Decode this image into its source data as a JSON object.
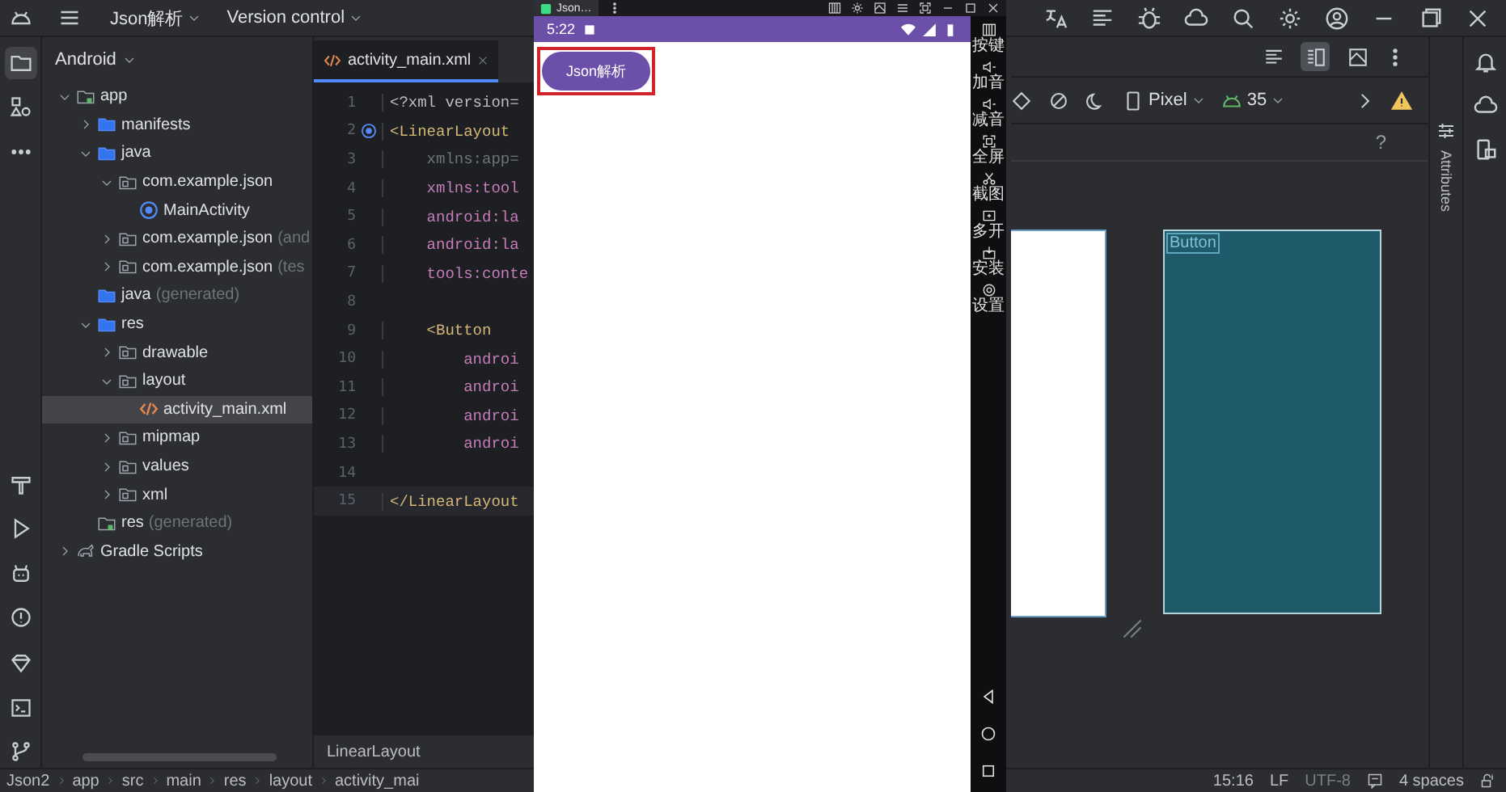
{
  "top_bar": {
    "project": "Json解析",
    "vcs": "Version control"
  },
  "left_toolbar": [
    {
      "selected": true
    },
    {
      "selected": false
    },
    {
      "selected": false
    },
    {
      "selected": false
    },
    {
      "selected": false
    },
    {
      "selected": false
    },
    {
      "selected": false
    },
    {
      "selected": false
    },
    {
      "selected": false
    },
    {
      "selected": false
    }
  ],
  "project_panel": {
    "view": "Android",
    "tree": [
      {
        "label": "app",
        "kind": "module",
        "expanded": true,
        "selected": false,
        "children": [
          {
            "label": "manifests",
            "kind": "folder",
            "expanded": false,
            "selected": false
          },
          {
            "label": "java",
            "kind": "folder",
            "expanded": true,
            "selected": false,
            "children": [
              {
                "label": "com.example.json",
                "kind": "package",
                "expanded": true,
                "selected": false,
                "children": [
                  {
                    "label": "MainActivity",
                    "kind": "class",
                    "selected": false
                  }
                ]
              },
              {
                "label": "com.example.json",
                "note": "(and",
                "kind": "package",
                "expanded": false,
                "selected": false
              },
              {
                "label": "com.example.json",
                "note": "(tes",
                "kind": "package",
                "expanded": false,
                "selected": false
              }
            ]
          },
          {
            "label": "java",
            "note": "(generated)",
            "kind": "folder",
            "selected": false
          },
          {
            "label": "res",
            "kind": "folder",
            "expanded": true,
            "selected": false,
            "children": [
              {
                "label": "drawable",
                "kind": "package",
                "expanded": false,
                "selected": false
              },
              {
                "label": "layout",
                "kind": "package",
                "expanded": true,
                "selected": false,
                "children": [
                  {
                    "label": "activity_main.xml",
                    "kind": "xml",
                    "selected": true
                  }
                ]
              },
              {
                "label": "mipmap",
                "kind": "package",
                "expanded": false,
                "selected": false
              },
              {
                "label": "values",
                "kind": "package",
                "expanded": false,
                "selected": false
              },
              {
                "label": "xml",
                "kind": "package",
                "expanded": false,
                "selected": false
              }
            ]
          },
          {
            "label": "res",
            "note": "(generated)",
            "kind": "module",
            "selected": false
          }
        ]
      },
      {
        "label": "Gradle Scripts",
        "kind": "gradle",
        "expanded": false,
        "selected": false
      }
    ]
  },
  "editor": {
    "tab": "activity_main.xml",
    "breadcrumb": "LinearLayout",
    "lines": [
      {
        "number": "1",
        "text": "<?xml version=",
        "kind": "plain",
        "marker": false,
        "current": false
      },
      {
        "number": "2",
        "text": "<LinearLayout",
        "kind": "tag",
        "marker": true,
        "current": false
      },
      {
        "number": "3",
        "text": "    xmlns:app=",
        "kind": "dim",
        "marker": false,
        "current": false
      },
      {
        "number": "4",
        "text": "    xmlns:tool",
        "kind": "attr",
        "marker": false,
        "current": false
      },
      {
        "number": "5",
        "text": "    android:la",
        "kind": "attr",
        "marker": false,
        "current": false
      },
      {
        "number": "6",
        "text": "    android:la",
        "kind": "attr",
        "marker": false,
        "current": false
      },
      {
        "number": "7",
        "text": "    tools:conte",
        "kind": "attr",
        "marker": false,
        "current": false
      },
      {
        "number": "8",
        "kind": "plain",
        "marker": false,
        "current": false
      },
      {
        "number": "9",
        "text": "    <Button",
        "kind": "tag",
        "marker": false,
        "current": false
      },
      {
        "number": "10",
        "text": "        androi",
        "kind": "attr",
        "marker": false,
        "current": false
      },
      {
        "number": "11",
        "text": "        androi",
        "kind": "attr",
        "marker": false,
        "current": false
      },
      {
        "number": "12",
        "text": "        androi",
        "kind": "attr",
        "marker": false,
        "current": false
      },
      {
        "number": "13",
        "text": "        androi",
        "kind": "attr",
        "marker": false,
        "current": false
      },
      {
        "number": "14",
        "kind": "plain",
        "marker": false,
        "current": false
      },
      {
        "number": "15",
        "text": "</LinearLayout",
        "kind": "tag",
        "marker": false,
        "current": true
      }
    ]
  },
  "emulator": {
    "tab": "Json…",
    "time": "5:22",
    "app_button": "Json解析",
    "side_tools": [
      "按键",
      "加音",
      "减音",
      "全屏",
      "截图",
      "多开",
      "安装",
      "设置"
    ]
  },
  "design": {
    "device": "Pixel",
    "api": "35",
    "help": "?",
    "blueprint_label": "Button",
    "attributes": "Attributes"
  },
  "status_bar": {
    "path": [
      "Json2",
      "app",
      "src",
      "main",
      "res",
      "layout",
      "activity_mai"
    ],
    "position": "15:16",
    "line_sep": "LF",
    "encoding": "UTF-8",
    "indent": "4 spaces"
  }
}
